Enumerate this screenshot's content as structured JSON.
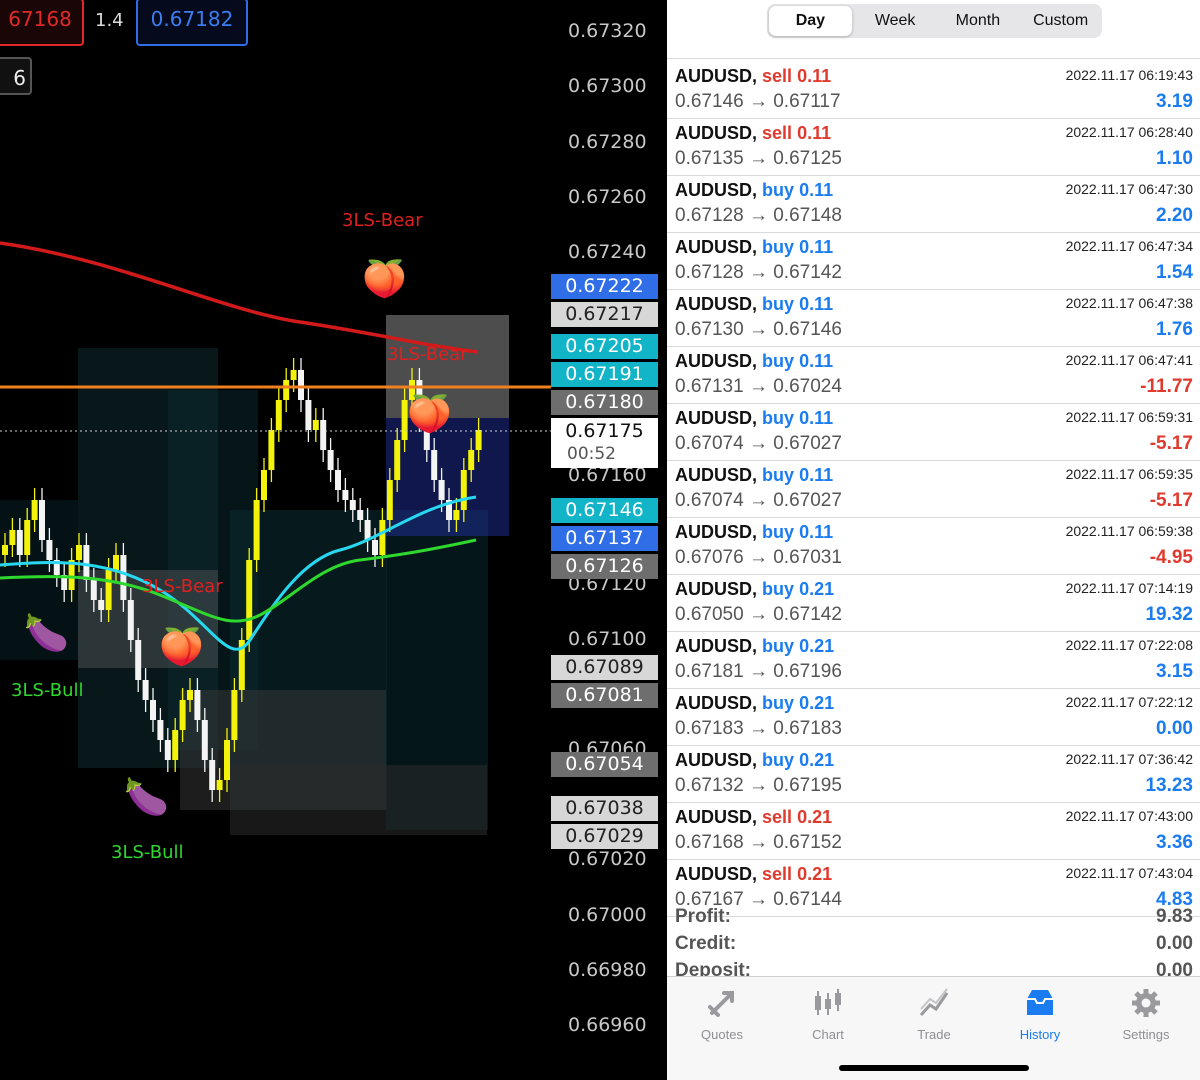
{
  "chart": {
    "top_left_tag": "67168",
    "top_left_tag_value": "0.67168",
    "spread": "1.4",
    "top_right_tag": "0.67182",
    "period_tag": "6",
    "price_axis": [
      "0.67320",
      "0.67300",
      "0.67280",
      "0.67260",
      "0.67240",
      "0.67160",
      "0.67120",
      "0.67100",
      "0.67060",
      "0.67020",
      "0.67000",
      "0.66980",
      "0.66960"
    ],
    "price_tags": [
      {
        "text": "0.67222",
        "color": "#2f6ee6"
      },
      {
        "text": "0.67217",
        "color": "#d7d7d7"
      },
      {
        "text": "0.67205",
        "color": "#12b4c8"
      },
      {
        "text": "0.67191",
        "color": "#12b4c8"
      },
      {
        "text": "0.67180",
        "color": "#6e6e6e"
      },
      {
        "text": "0.67146",
        "color": "#12b4c8"
      },
      {
        "text": "0.67137",
        "color": "#2f6ee6"
      },
      {
        "text": "0.67126",
        "color": "#6e6e6e"
      },
      {
        "text": "0.67089",
        "color": "#d7d7d7"
      },
      {
        "text": "0.67081",
        "color": "#6e6e6e"
      },
      {
        "text": "0.67054",
        "color": "#6e6e6e"
      },
      {
        "text": "0.67038",
        "color": "#d7d7d7"
      },
      {
        "text": "0.67029",
        "color": "#d7d7d7"
      }
    ],
    "current_price": "0.67175",
    "countdown": "00:52",
    "patterns": [
      {
        "text": "3LS-Bear",
        "color": "#e02020"
      },
      {
        "text": "3LS-Bear",
        "color": "#e02020"
      },
      {
        "text": "3LS-Bear",
        "color": "#e02020"
      },
      {
        "text": "3LS-Bull",
        "color": "#2ed82e"
      },
      {
        "text": "3LS-Bull",
        "color": "#2ed82e"
      }
    ],
    "markers": {
      "bear": "🍑",
      "bull": "🍆"
    }
  },
  "history": {
    "tabs": [
      "Day",
      "Week",
      "Month",
      "Custom"
    ],
    "active_tab": "Day",
    "deals": [
      {
        "symbol": "AUDUSD,",
        "side": "sell",
        "volume": "0.11",
        "prices": "0.67146 → 0.67117",
        "time": "2022.11.17 06:19:43",
        "profit": "3.19"
      },
      {
        "symbol": "AUDUSD,",
        "side": "sell",
        "volume": "0.11",
        "prices": "0.67135 → 0.67125",
        "time": "2022.11.17 06:28:40",
        "profit": "1.10"
      },
      {
        "symbol": "AUDUSD,",
        "side": "buy",
        "volume": "0.11",
        "prices": "0.67128 → 0.67148",
        "time": "2022.11.17 06:47:30",
        "profit": "2.20"
      },
      {
        "symbol": "AUDUSD,",
        "side": "buy",
        "volume": "0.11",
        "prices": "0.67128 → 0.67142",
        "time": "2022.11.17 06:47:34",
        "profit": "1.54"
      },
      {
        "symbol": "AUDUSD,",
        "side": "buy",
        "volume": "0.11",
        "prices": "0.67130 → 0.67146",
        "time": "2022.11.17 06:47:38",
        "profit": "1.76"
      },
      {
        "symbol": "AUDUSD,",
        "side": "buy",
        "volume": "0.11",
        "prices": "0.67131 → 0.67024",
        "time": "2022.11.17 06:47:41",
        "profit": "-11.77"
      },
      {
        "symbol": "AUDUSD,",
        "side": "buy",
        "volume": "0.11",
        "prices": "0.67074 → 0.67027",
        "time": "2022.11.17 06:59:31",
        "profit": "-5.17"
      },
      {
        "symbol": "AUDUSD,",
        "side": "buy",
        "volume": "0.11",
        "prices": "0.67074 → 0.67027",
        "time": "2022.11.17 06:59:35",
        "profit": "-5.17"
      },
      {
        "symbol": "AUDUSD,",
        "side": "buy",
        "volume": "0.11",
        "prices": "0.67076 → 0.67031",
        "time": "2022.11.17 06:59:38",
        "profit": "-4.95"
      },
      {
        "symbol": "AUDUSD,",
        "side": "buy",
        "volume": "0.21",
        "prices": "0.67050 → 0.67142",
        "time": "2022.11.17 07:14:19",
        "profit": "19.32"
      },
      {
        "symbol": "AUDUSD,",
        "side": "buy",
        "volume": "0.21",
        "prices": "0.67181 → 0.67196",
        "time": "2022.11.17 07:22:08",
        "profit": "3.15"
      },
      {
        "symbol": "AUDUSD,",
        "side": "buy",
        "volume": "0.21",
        "prices": "0.67183 → 0.67183",
        "time": "2022.11.17 07:22:12",
        "profit": "0.00"
      },
      {
        "symbol": "AUDUSD,",
        "side": "buy",
        "volume": "0.21",
        "prices": "0.67132 → 0.67195",
        "time": "2022.11.17 07:36:42",
        "profit": "13.23"
      },
      {
        "symbol": "AUDUSD,",
        "side": "sell",
        "volume": "0.21",
        "prices": "0.67168 → 0.67152",
        "time": "2022.11.17 07:43:00",
        "profit": "3.36"
      },
      {
        "symbol": "AUDUSD,",
        "side": "sell",
        "volume": "0.21",
        "prices": "0.67167 → 0.67144",
        "time": "2022.11.17 07:43:04",
        "profit": "4.83"
      }
    ],
    "summary": [
      {
        "label": "Profit:",
        "value": "9.83"
      },
      {
        "label": "Credit:",
        "value": "0.00"
      },
      {
        "label": "Deposit:",
        "value": "0.00"
      }
    ],
    "colors": {
      "sell": "#e03a2e",
      "buy": "#1a7cf0",
      "positive": "#1a7cf0",
      "negative": "#e03a2e"
    }
  },
  "tabbar": {
    "items": [
      {
        "label": "Quotes",
        "icon": "quotes-icon"
      },
      {
        "label": "Chart",
        "icon": "chart-icon"
      },
      {
        "label": "Trade",
        "icon": "trade-icon"
      },
      {
        "label": "History",
        "icon": "history-icon"
      },
      {
        "label": "Settings",
        "icon": "settings-icon"
      }
    ],
    "active": "History"
  }
}
